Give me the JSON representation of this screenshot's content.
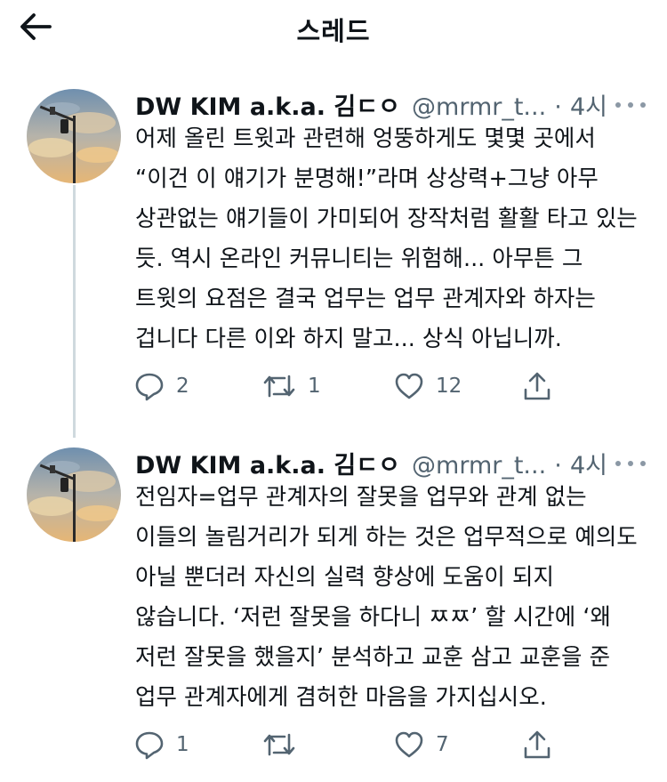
{
  "header": {
    "title": "스레드"
  },
  "tweets": [
    {
      "author_name": "DW KIM a.k.a. 김ㄷㅇ",
      "handle": "@mrmr_t...",
      "separator": "·",
      "time": "4시",
      "text": "어제 올린 트윗과 관련해 엉뚱하게도 몇몇 곳에서 “이건 이 얘기가 분명해!”라며 상상력+그냥 아무 상관없는 얘기들이 가미되어 장작처럼 활활 타고 있는 듯. 역시 온라인 커뮤니티는 위험해... 아무튼 그 트윗의 요점은 결국 업무는 업무 관계자와 하자는 겁니다 다른 이와 하지 말고... 상식 아닙니까.",
      "replies": "2",
      "retweets": "1",
      "likes": "12"
    },
    {
      "author_name": "DW KIM a.k.a. 김ㄷㅇ",
      "handle": "@mrmr_t...",
      "separator": "·",
      "time": "4시",
      "text": "전임자=업무 관계자의 잘못을 업무와 관계 없는 이들의 놀림거리가 되게 하는 것은 업무적으로 예의도 아닐 뿐더러 자신의 실력 향상에 도움이 되지 않습니다. ‘저런 잘못을 하다니 ㅉㅉ’ 할 시간에 ‘왜 저런 잘못을 했을지’ 분석하고 교훈 삼고 교훈을 준 업무 관계자에게 겸허한 마음을 가지십시오.",
      "replies": "1",
      "retweets": "",
      "likes": "7"
    }
  ],
  "icons": {
    "back": "arrow-left-icon",
    "more": "more-icon",
    "reply": "reply-icon",
    "retweet": "retweet-icon",
    "like": "heart-icon",
    "share": "share-icon"
  },
  "colors": {
    "text": "#0f1419",
    "secondary": "#536471",
    "thread_line": "#cfd9de"
  }
}
